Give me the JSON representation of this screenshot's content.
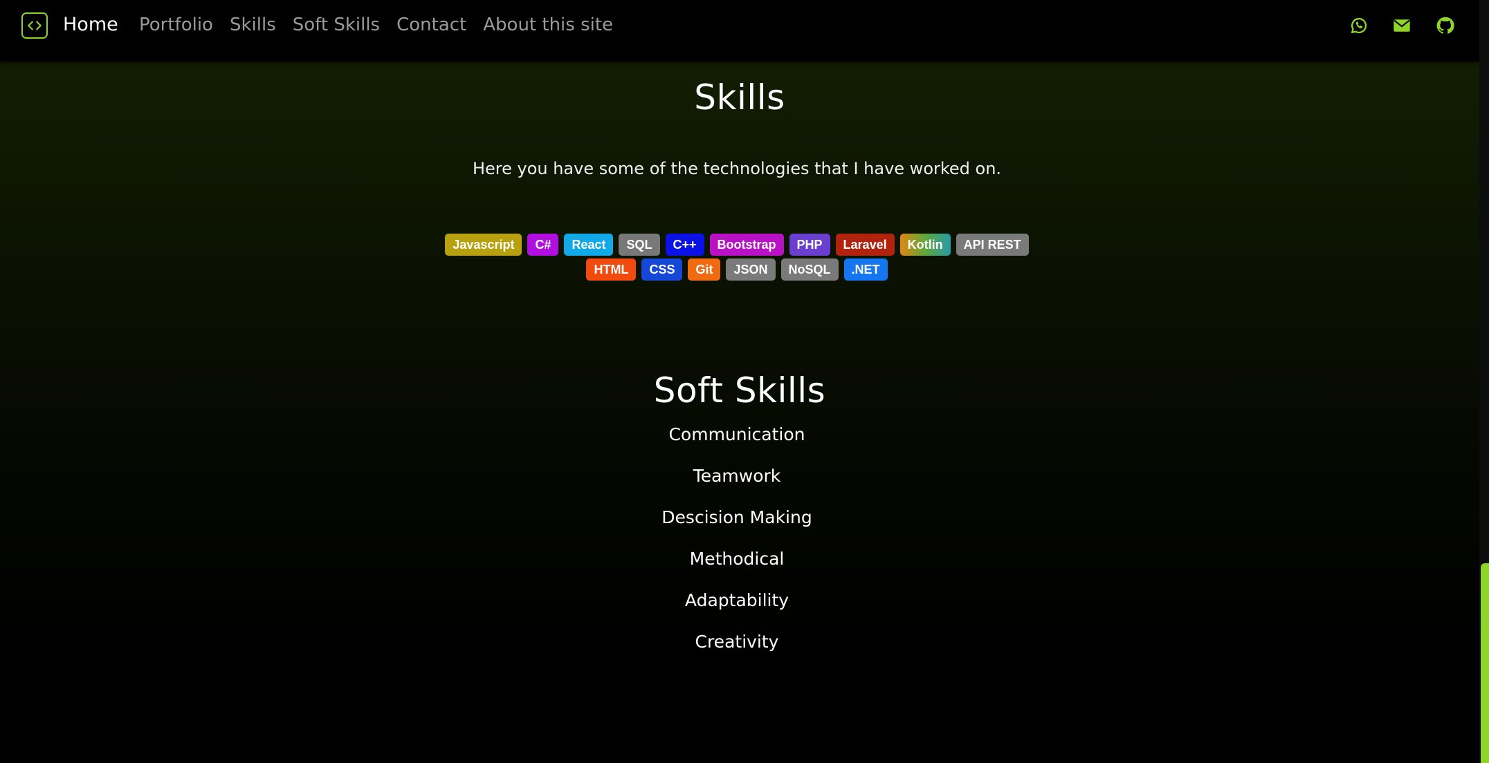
{
  "nav": {
    "home": "Home",
    "links": [
      "Portfolio",
      "Skills",
      "Soft Skills",
      "Contact",
      "About this site"
    ],
    "icons": [
      "whatsapp-icon",
      "mail-icon",
      "github-icon"
    ],
    "accent": "#8fd428"
  },
  "skills": {
    "title": "Skills",
    "intro": "Here you have some of the technologies that I have worked on.",
    "row1": [
      {
        "label": "Javascript",
        "color": "#b8a10f"
      },
      {
        "label": "C#",
        "color": "#b10ee0"
      },
      {
        "label": "React",
        "color": "#12a9e8"
      },
      {
        "label": "SQL",
        "color": "#787878"
      },
      {
        "label": "C++",
        "color": "#0a12e6"
      },
      {
        "label": "Bootstrap",
        "color": "#b812c4"
      },
      {
        "label": "PHP",
        "color": "#6a3fd0"
      },
      {
        "label": "Laravel",
        "color": "#b2230d"
      },
      {
        "label": "Kotlin",
        "color": "linear-gradient(90deg,#e0890f,#5ea83c,#2a9aa8)"
      },
      {
        "label": "API REST",
        "color": "#7a7a7a"
      }
    ],
    "row2": [
      {
        "label": "HTML",
        "color": "#f04a0e"
      },
      {
        "label": "CSS",
        "color": "#1548d6"
      },
      {
        "label": "Git",
        "color": "#f06a12"
      },
      {
        "label": "JSON",
        "color": "#7a7a7a"
      },
      {
        "label": "NoSQL",
        "color": "#7a7a7a"
      },
      {
        "label": ".NET",
        "color": "#1476f0"
      }
    ]
  },
  "soft_skills": {
    "title": "Soft Skills",
    "items": [
      "Communication",
      "Teamwork",
      "Descision Making",
      "Methodical",
      "Adaptability",
      "Creativity"
    ]
  }
}
